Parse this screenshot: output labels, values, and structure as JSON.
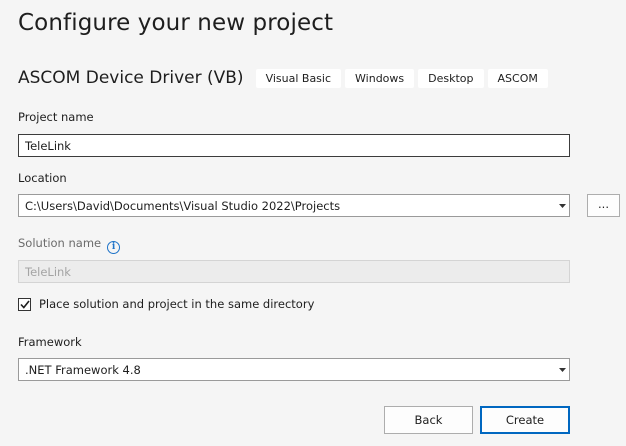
{
  "header": {
    "title": "Configure your new project"
  },
  "template": {
    "name": "ASCOM Device Driver (VB)",
    "tags": [
      "Visual Basic",
      "Windows",
      "Desktop",
      "ASCOM"
    ]
  },
  "project_name": {
    "label": "Project name",
    "value": "TeleLink"
  },
  "location": {
    "label": "Location",
    "value": "C:\\Users\\David\\Documents\\Visual Studio 2022\\Projects",
    "browse_label": "..."
  },
  "solution_name": {
    "label": "Solution name",
    "info_icon": "info-icon",
    "value": "TeleLink"
  },
  "same_directory": {
    "label": "Place solution and project in the same directory",
    "checked": true
  },
  "framework": {
    "label": "Framework",
    "value": ".NET Framework 4.8"
  },
  "footer": {
    "back_label": "Back",
    "create_label": "Create"
  },
  "colors": {
    "background": "#f5f5f5",
    "accent": "#0067c0",
    "info": "#1e73c8"
  }
}
